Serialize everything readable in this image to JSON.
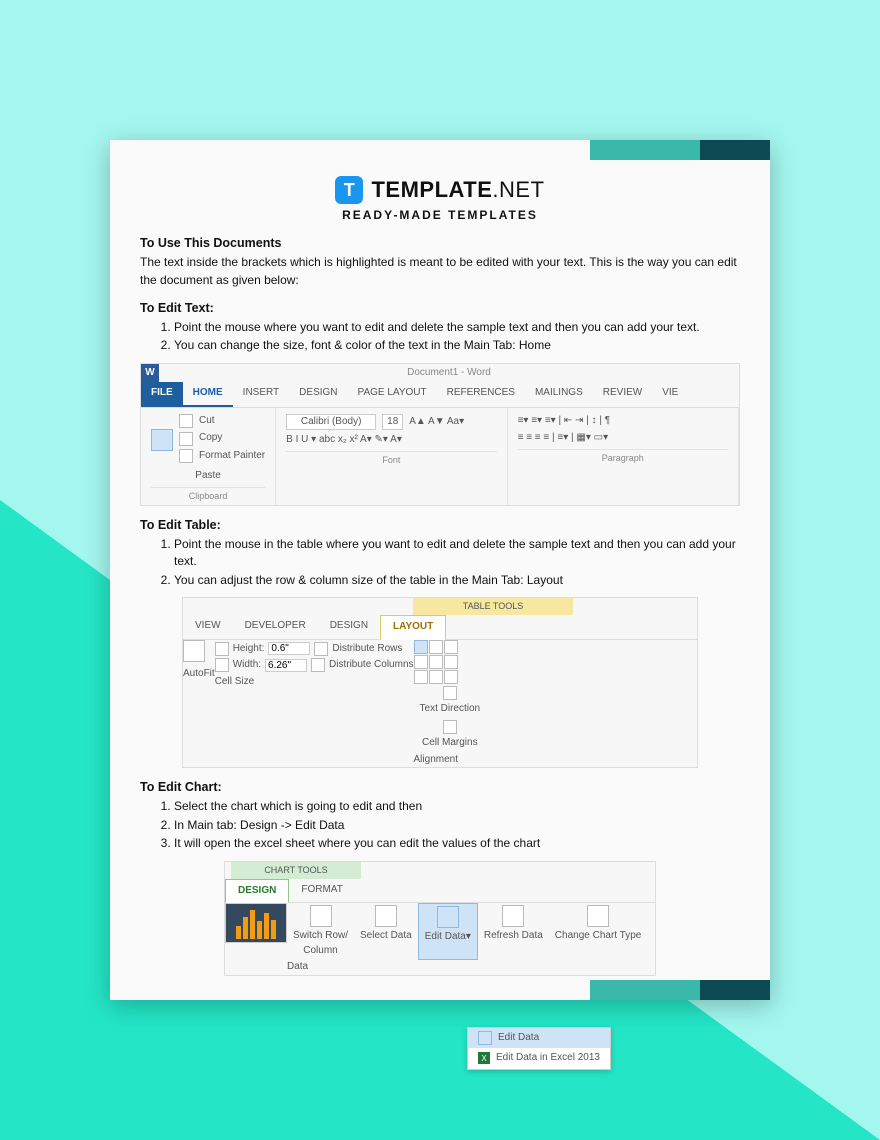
{
  "brand": {
    "icon_letter": "T",
    "name": "TEMPLATE",
    "suffix": ".NET",
    "subtitle": "READY-MADE TEMPLATES"
  },
  "section_use": {
    "heading": "To Use This Documents",
    "intro": "The text inside the brackets which is highlighted is meant to be edited with your text. This is the way you can edit the document as given below:"
  },
  "section_text": {
    "heading": "To Edit Text:",
    "steps": [
      "Point the mouse where you want to edit and delete the sample text and then you can add your text.",
      "You can change the size, font & color of the text in the Main Tab: Home"
    ]
  },
  "ribbon_home": {
    "doc_title": "Document1 - Word",
    "tabs": {
      "file": "FILE",
      "home": "HOME",
      "insert": "INSERT",
      "design": "DESIGN",
      "page_layout": "PAGE LAYOUT",
      "references": "REFERENCES",
      "mailings": "MAILINGS",
      "review": "REVIEW",
      "view": "VIE"
    },
    "clipboard": {
      "paste": "Paste",
      "cut": "Cut",
      "copy": "Copy",
      "fmt": "Format Painter",
      "cap": "Clipboard"
    },
    "font": {
      "name": "Calibri (Body)",
      "size": "18",
      "cap": "Font",
      "buttons": "B  I  U ▾  abc  x₂  x²  A▾  ✎▾  A▾"
    },
    "paragraph": {
      "cap": "Paragraph"
    }
  },
  "section_table": {
    "heading": "To Edit Table:",
    "steps": [
      "Point the mouse in the table where you want to edit and delete the sample text and then you can add your text.",
      "You can adjust the row & column size of the table in the Main Tab: Layout"
    ]
  },
  "ribbon_table": {
    "ctx": "TABLE TOOLS",
    "tabs": {
      "view": "VIEW",
      "developer": "DEVELOPER",
      "design": "DESIGN",
      "layout": "LAYOUT"
    },
    "autofit": "AutoFit",
    "height_lbl": "Height:",
    "height_val": "0.6\"",
    "width_lbl": "Width:",
    "width_val": "6.26\"",
    "dist_rows": "Distribute Rows",
    "dist_cols": "Distribute Columns",
    "cap_size": "Cell Size",
    "text_dir": "Text Direction",
    "cell_marg": "Cell Margins",
    "cap_align": "Alignment"
  },
  "section_chart": {
    "heading": "To Edit Chart:",
    "steps": [
      "Select the chart which is going to edit and then",
      "In Main tab: Design -> Edit Data",
      "It will open the excel sheet where you can edit the values of the chart"
    ]
  },
  "ribbon_chart": {
    "ctx": "CHART TOOLS",
    "tabs": {
      "design": "DESIGN",
      "format": "FORMAT"
    },
    "switch": "Switch Row/\nColumn",
    "select": "Select Data",
    "edit": "Edit Data▾",
    "refresh": "Refresh Data",
    "change": "Change Chart Type",
    "cap_data": "Data",
    "menu1": "Edit Data",
    "menu2": "Edit Data in Excel 2013"
  }
}
